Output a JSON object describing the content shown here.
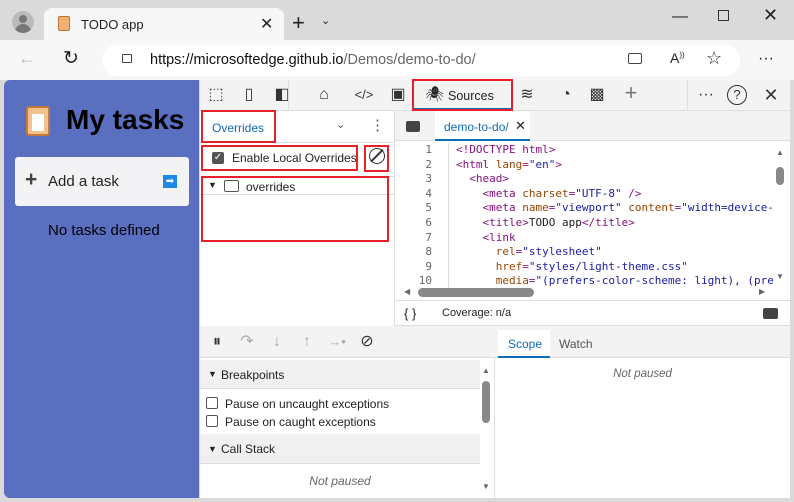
{
  "browser": {
    "tab_title": "TODO app",
    "url_host": "https://microsoftedge.github.io",
    "url_path": "/Demos/demo-to-do/"
  },
  "app": {
    "title": "My tasks",
    "add_task": "Add a task",
    "empty": "No tasks defined",
    "bg_color": "#5b6fc1"
  },
  "devtools": {
    "active_tool": "Sources",
    "left": {
      "tab": "Overrides",
      "enable_label": "Enable Local Overrides",
      "enabled": true,
      "folder": "overrides"
    },
    "editor": {
      "file_tab": "demo-to-do/",
      "coverage": "Coverage: n/a",
      "lines": [
        {
          "n": "1",
          "html": "<span class='tag'>&lt;!DOCTYPE html&gt;</span>"
        },
        {
          "n": "2",
          "html": "<span class='tag'>&lt;html </span><span class='attr'>lang</span><span class='tag'>=</span><span class='val'>\"en\"</span><span class='tag'>&gt;</span>"
        },
        {
          "n": "3",
          "html": "  <span class='tag'>&lt;head&gt;</span>"
        },
        {
          "n": "4",
          "html": "    <span class='tag'>&lt;meta </span><span class='attr'>charset</span><span class='tag'>=</span><span class='val'>\"UTF-8\"</span><span class='tag'> /&gt;</span>"
        },
        {
          "n": "5",
          "html": "    <span class='tag'>&lt;meta </span><span class='attr'>name</span><span class='tag'>=</span><span class='val'>\"viewport\"</span> <span class='attr'>content</span><span class='tag'>=</span><span class='val'>\"width=device-width</span>"
        },
        {
          "n": "6",
          "html": "    <span class='tag'>&lt;title&gt;</span>TODO app<span class='tag'>&lt;/title&gt;</span>"
        },
        {
          "n": "7",
          "html": "    <span class='tag'>&lt;link</span>"
        },
        {
          "n": "8",
          "html": "      <span class='attr'>rel</span><span class='tag'>=</span><span class='val'>\"stylesheet\"</span>"
        },
        {
          "n": "9",
          "html": "      <span class='attr'>href</span><span class='tag'>=</span><span class='val'>\"styles/light-theme.css\"</span>"
        },
        {
          "n": "10",
          "html": "      <span class='attr'>media</span><span class='tag'>=</span><span class='val'>\"(prefers-color-scheme: light), (prefers</span>"
        }
      ]
    },
    "debugger": {
      "breakpoints": "Breakpoints",
      "pause_uncaught": "Pause on uncaught exceptions",
      "pause_caught": "Pause on caught exceptions",
      "call_stack": "Call Stack",
      "call_stack_status": "Not paused",
      "scope_tab": "Scope",
      "watch_tab": "Watch",
      "scope_status": "Not paused"
    }
  }
}
